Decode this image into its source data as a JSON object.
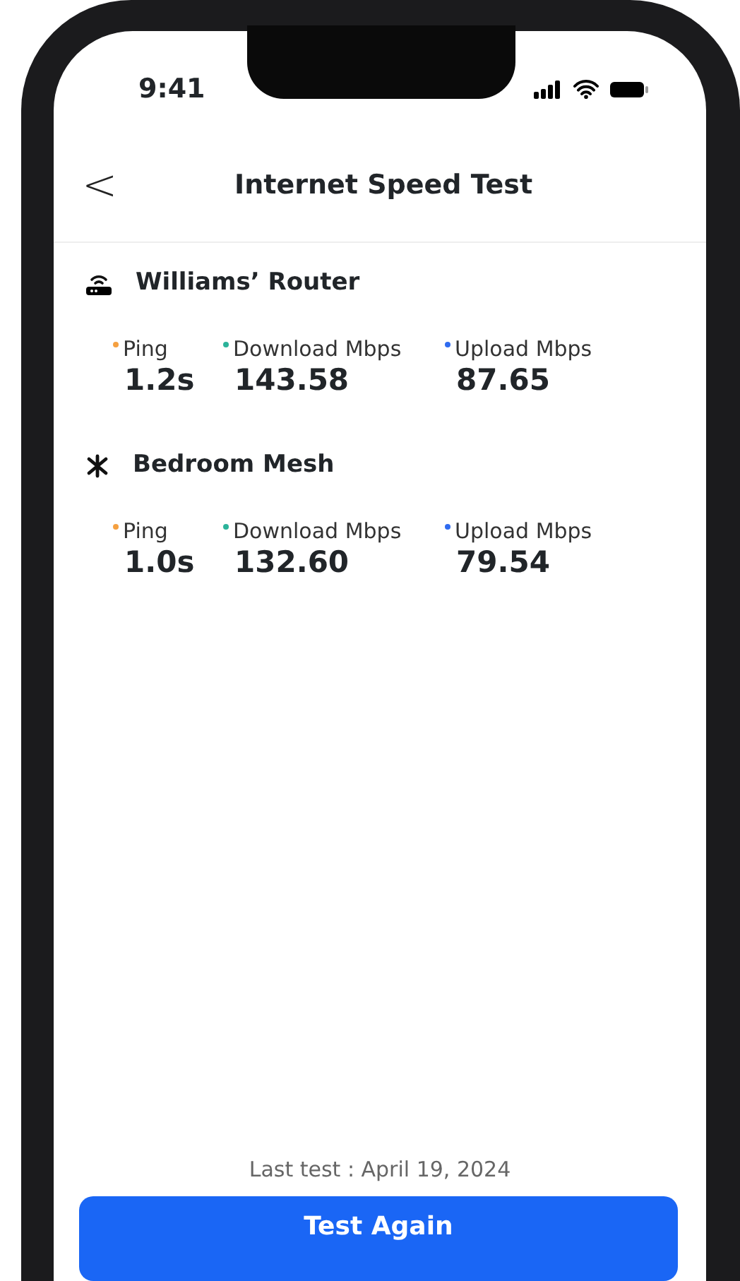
{
  "status_bar": {
    "time": "9:41"
  },
  "header": {
    "back": "<",
    "title": "Internet Speed Test"
  },
  "devices": [
    {
      "kind": "router",
      "name": "Williams’ Router",
      "metrics": [
        {
          "label": "Ping",
          "value": "1.2s",
          "color": "#f5a040"
        },
        {
          "label": "Download Mbps",
          "value": "143.58",
          "color": "#2bb39a"
        },
        {
          "label": "Upload Mbps",
          "value": "87.65",
          "color": "#2f6bf0"
        }
      ]
    },
    {
      "kind": "mesh",
      "name": "Bedroom Mesh",
      "metrics": [
        {
          "label": "Ping",
          "value": "1.0s",
          "color": "#f5a040"
        },
        {
          "label": "Download Mbps",
          "value": "132.60",
          "color": "#2bb39a"
        },
        {
          "label": "Upload Mbps",
          "value": "79.54",
          "color": "#2f6bf0"
        }
      ]
    }
  ],
  "footer": {
    "last_test": "Last test : April 19, 2024",
    "button": "Test Again"
  }
}
